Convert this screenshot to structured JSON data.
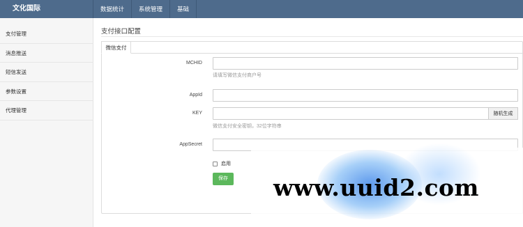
{
  "app": {
    "brand": "文化国际"
  },
  "topnav": {
    "items": [
      "数据统计",
      "系统管理",
      "基础"
    ]
  },
  "sidebar": {
    "items": [
      "支付管理",
      "消息推送",
      "短信发送",
      "参数设置",
      "代理管理"
    ]
  },
  "main": {
    "title": "支付接口配置",
    "tab": "微信支付",
    "fields": {
      "mchid": {
        "label": "MCHID",
        "value": "",
        "hint": "请填写微信支付商户号"
      },
      "appid": {
        "label": "AppId",
        "value": ""
      },
      "key": {
        "label": "KEY",
        "value": "",
        "hint": "微信支付安全密钥，32位字符串",
        "button": "随机生成"
      },
      "appsecret": {
        "label": "AppSecret",
        "value": ""
      }
    },
    "enable": {
      "label": "启用",
      "checked": false
    },
    "save": "保存"
  },
  "watermark": {
    "text": "www.uuid2.com"
  }
}
